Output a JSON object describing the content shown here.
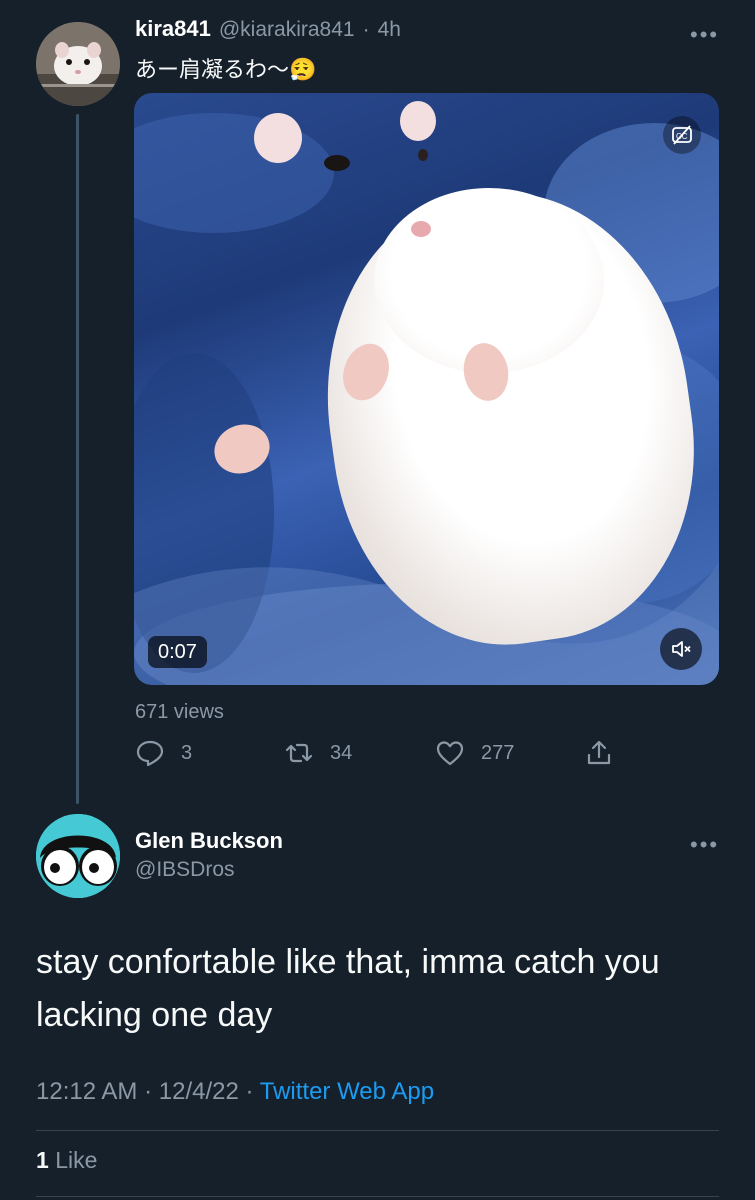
{
  "parent_tweet": {
    "name": "kira841",
    "handle": "@kiarakira841",
    "separator": "·",
    "time_ago": "4h",
    "text": "あー肩凝るわ〜😮‍💨",
    "more_icon": "more-dots-icon",
    "video": {
      "duration": "0:07",
      "caption_icon": "captions-off-icon",
      "mute_icon": "muted-speaker-icon"
    },
    "views": "671 views",
    "actions": {
      "replies": "3",
      "retweets": "34",
      "likes": "277"
    }
  },
  "reply_tweet": {
    "name": "Glen Buckson",
    "handle": "@IBSDros",
    "more_icon": "more-dots-icon",
    "text": "stay confortable like that, imma catch you lacking one day",
    "time": "12:12 AM",
    "date": "12/4/22",
    "separator": "·",
    "source": "Twitter Web App",
    "like_count": "1",
    "like_label": "Like"
  },
  "colors": {
    "background": "#15202b",
    "text_muted": "#8b98a5",
    "link": "#1d9bf0",
    "divider": "#38444d"
  }
}
